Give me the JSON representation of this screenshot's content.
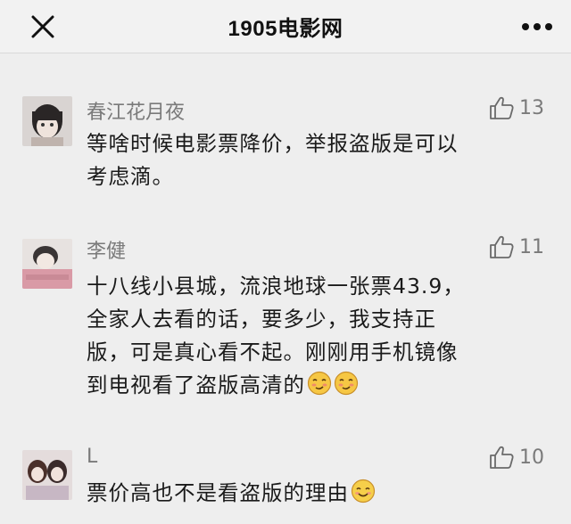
{
  "header": {
    "title": "1905电影网",
    "close_icon": "close-icon",
    "more_icon": "more-dots-icon"
  },
  "comments": [
    {
      "user": "春江花月夜",
      "likes": "13",
      "lines": [
        "等啥时候电影票降价，举报盗版是可以",
        "考虑滴。"
      ],
      "emojis": []
    },
    {
      "user": "李健",
      "likes": "11",
      "lines": [
        "十八线小县城，流浪地球一张票43.9，",
        "全家人去看的话，要多少，我支持正",
        "版，可是真心看不起。刚刚用手机镜像",
        "到电视看了盗版高清的"
      ],
      "emojis": [
        "smirk-emoji",
        "smirk-emoji"
      ]
    },
    {
      "user": "L",
      "likes": "10",
      "lines": [
        "票价高也不是看盗版的理由"
      ],
      "emojis": [
        "smile-emoji"
      ]
    }
  ],
  "colors": {
    "background": "#eeeeee",
    "meta_text": "#7a7a7a",
    "body_text": "#1a1a1a"
  }
}
